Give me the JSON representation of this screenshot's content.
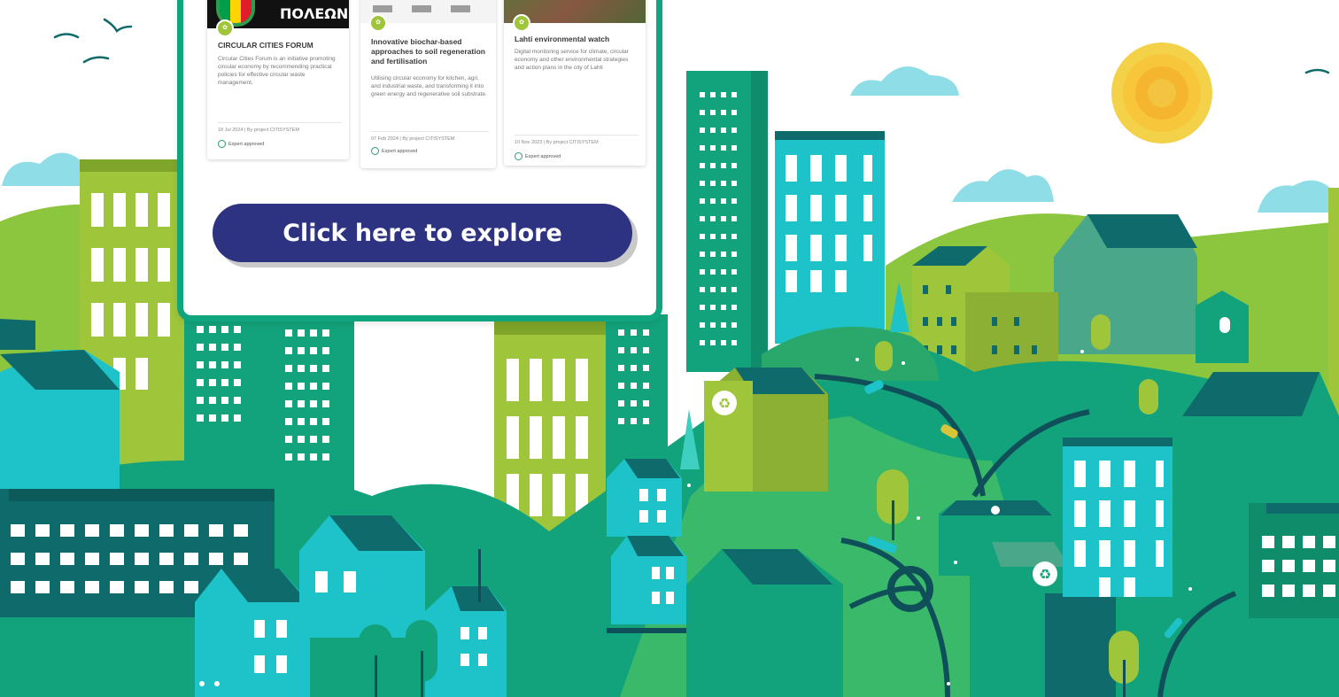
{
  "colors": {
    "accent_green": "#0fa57f",
    "button_navy": "#2d3381",
    "lime": "#9fc53a",
    "teal": "#1ec3c9",
    "dark_teal": "#0f6b6b",
    "sky": "#8fdde6",
    "sun": "#f3d24a"
  },
  "cards": [
    {
      "thumb_text": "ΠΟΛΕΩΝ",
      "title": "CIRCULAR CITIES FORUM",
      "description": "Circular Cities Forum is an initiative promoting circular economy by recommending practical policies for effective circular waste management.",
      "meta": "18 Jul 2024 | By project CITISYSTEM",
      "approved": "Expert approved"
    },
    {
      "thumb_text": "",
      "title": "Innovative biochar-based approaches to soil regeneration and fertilisation",
      "description": "Utilising circular economy for kitchen, agri, and industrial waste, and transforming it into green energy and regenerative soil substrate.",
      "meta": "07 Feb 2024 | By project CITISYSTEM",
      "approved": "Expert approved"
    },
    {
      "thumb_text": "",
      "title": "Lahti environmental watch",
      "description": "Digital monitoring service for climate, circular economy and other environmental strategies and action plans in the city of Lahti",
      "meta": "10 Nov 2023 | By project CITISYSTEM",
      "approved": "Expert approved"
    }
  ],
  "cta": {
    "label": "Click here to explore"
  }
}
